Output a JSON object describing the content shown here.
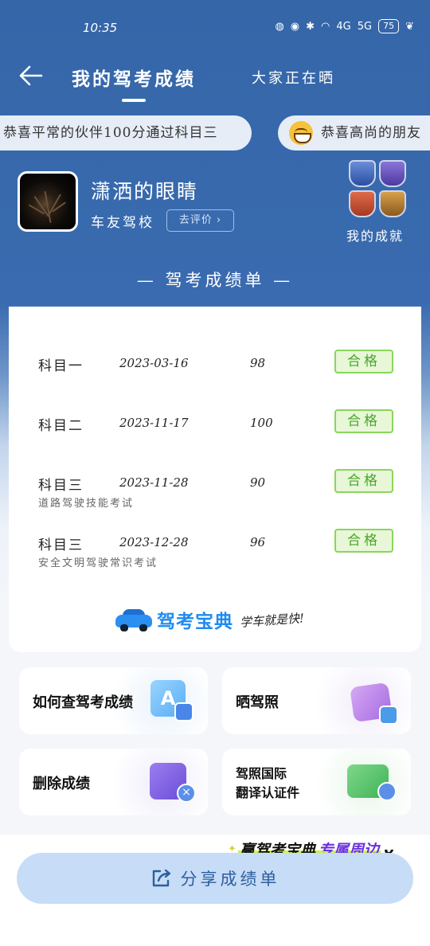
{
  "status_bar": {
    "time": "10:35",
    "signal_1": "4G",
    "signal_2": "5G",
    "battery": "75"
  },
  "nav": {
    "title": "我的驾考成绩",
    "tab_2": "大家正在晒"
  },
  "ticker": [
    {
      "text": "恭喜平常的伙伴100分通过科目三"
    },
    {
      "text": "恭喜高尚的朋友"
    }
  ],
  "profile": {
    "username": "潇洒的眼睛",
    "school": "车友驾校",
    "rate_button": "去评价",
    "achievements_label": "我的成就"
  },
  "sheet": {
    "title": "— 驾考成绩单 —",
    "rows": [
      {
        "subject": "科目一",
        "date": "2023-03-16",
        "score": "98",
        "status": "合格",
        "note": ""
      },
      {
        "subject": "科目二",
        "date": "2023-11-17",
        "score": "100",
        "status": "合格",
        "note": ""
      },
      {
        "subject": "科目三",
        "date": "2023-11-28",
        "score": "90",
        "status": "合格",
        "note": "道路驾驶技能考试"
      },
      {
        "subject": "科目三",
        "date": "2023-12-28",
        "score": "96",
        "status": "合格",
        "note": "安全文明驾驶常识考试"
      }
    ],
    "brand_name": "驾考宝典",
    "brand_slogan": "学车就是快!"
  },
  "tiles": {
    "t1": "如何查驾考成绩",
    "t2": "晒驾照",
    "t3": "删除成绩",
    "t4_line1": "驾照国际",
    "t4_line2": "翻译认证件"
  },
  "promo": {
    "part1": "赢驾考宝典",
    "part2": "专属周边"
  },
  "share_button": "分享成绩单",
  "colors": {
    "primary": "#3466a8",
    "pass_green": "#4aa52a",
    "brand_blue": "#1f8bf0",
    "share_bg": "#c7dcf6"
  }
}
